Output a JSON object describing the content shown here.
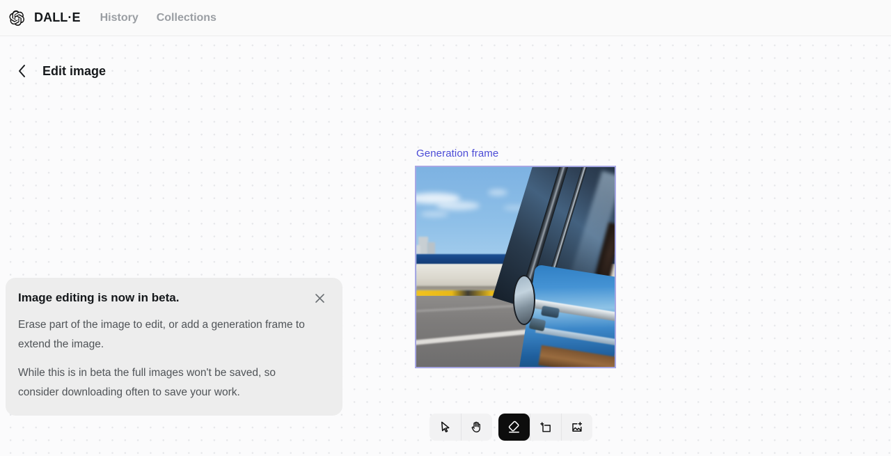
{
  "header": {
    "logo_icon": "openai-logo-icon",
    "brand": "DALL·E",
    "nav": [
      {
        "label": "History",
        "name": "nav-history"
      },
      {
        "label": "Collections",
        "name": "nav-collections"
      }
    ]
  },
  "page": {
    "back_icon": "chevron-left-icon",
    "title": "Edit image"
  },
  "frame": {
    "label": "Generation frame",
    "label_color": "#4b4bd6",
    "border_color": "#a7a7e4",
    "image_alt": "Blue vintage car driving along a seaside road with a sea wall and blue sky"
  },
  "notice": {
    "title": "Image editing is now in beta.",
    "paragraph1": "Erase part of the image to edit, or add a generation frame to extend the image.",
    "paragraph2": "While this is in beta the full images won't be saved, so consider downloading often to save your work.",
    "close_icon": "close-icon"
  },
  "toolbar": {
    "groups": [
      {
        "name": "navigation-tools",
        "tools": [
          {
            "name": "select-tool",
            "icon": "cursor-arrow-icon",
            "label": "Select",
            "active": false
          },
          {
            "name": "pan-tool",
            "icon": "hand-icon",
            "label": "Pan",
            "active": false
          }
        ]
      },
      {
        "name": "edit-tools",
        "tools": [
          {
            "name": "eraser-tool",
            "icon": "eraser-icon",
            "label": "Erase",
            "active": true
          },
          {
            "name": "add-frame-tool",
            "icon": "add-frame-icon",
            "label": "Add generation frame",
            "active": false
          },
          {
            "name": "add-image-tool",
            "icon": "add-image-icon",
            "label": "Add image",
            "active": false
          }
        ]
      }
    ]
  }
}
